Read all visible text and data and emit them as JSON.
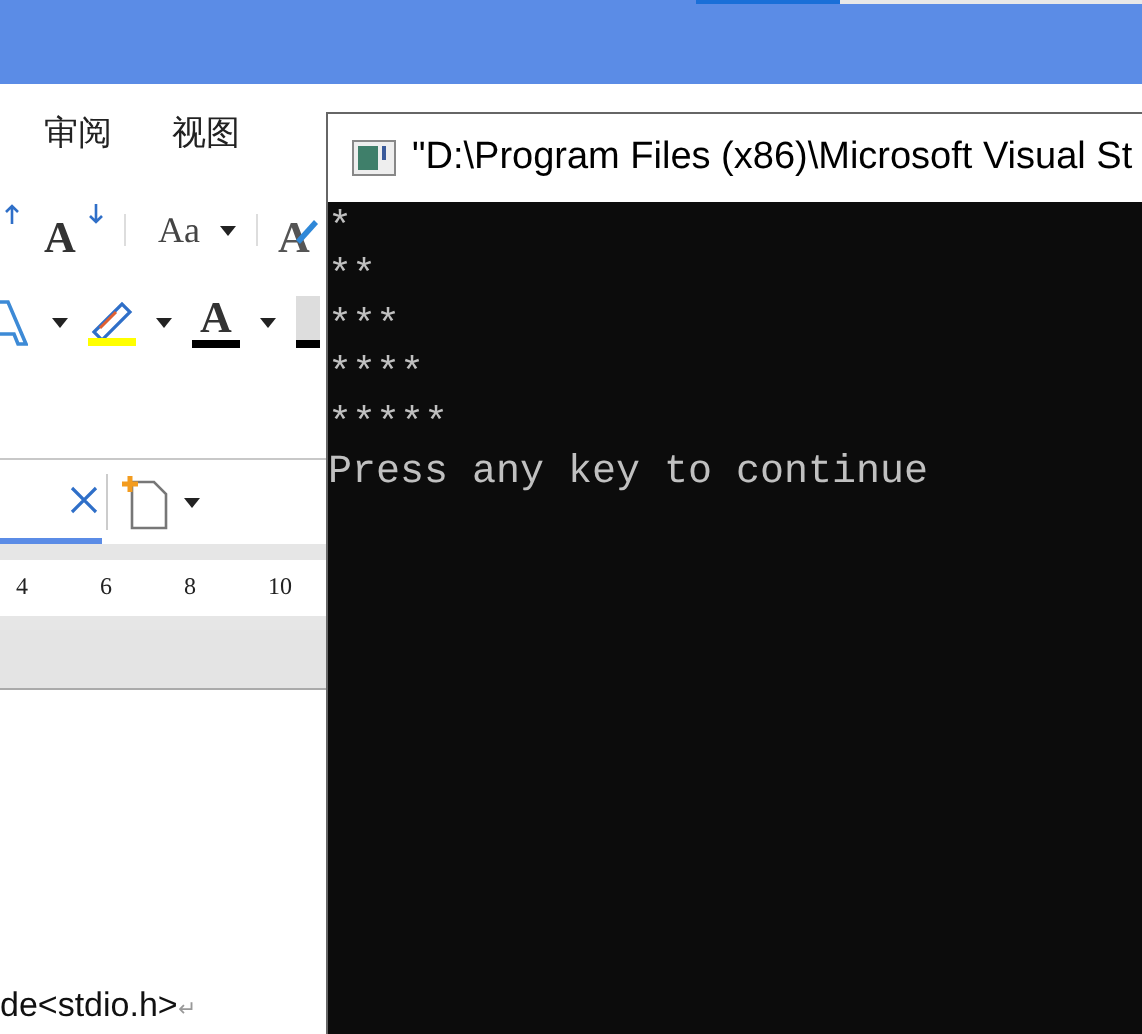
{
  "word": {
    "menu_tabs": [
      "审阅",
      "视图"
    ],
    "toolbar_row_1": [
      {
        "kind": "grow"
      },
      {
        "kind": "shrink",
        "glyph": "A"
      },
      {
        "kind": "case",
        "glyph": "Aa"
      },
      {
        "kind": "clear",
        "glyph": "A"
      }
    ],
    "toolbar_row_2": [
      {
        "kind": "effect"
      },
      {
        "kind": "highlight",
        "color": "#ffff00"
      },
      {
        "kind": "font_color",
        "glyph": "A",
        "color": "#000000"
      },
      {
        "kind": "shade",
        "color": "#000000"
      }
    ],
    "ruler": [
      "4",
      "6",
      "8",
      "10"
    ],
    "document_line": "de<stdio.h>",
    "paragraph_mark": "↵"
  },
  "console": {
    "title": "\"D:\\Program Files (x86)\\Microsoft Visual St",
    "lines": [
      "*",
      "**",
      "***",
      "****",
      "*****",
      "Press any key to continue"
    ]
  }
}
